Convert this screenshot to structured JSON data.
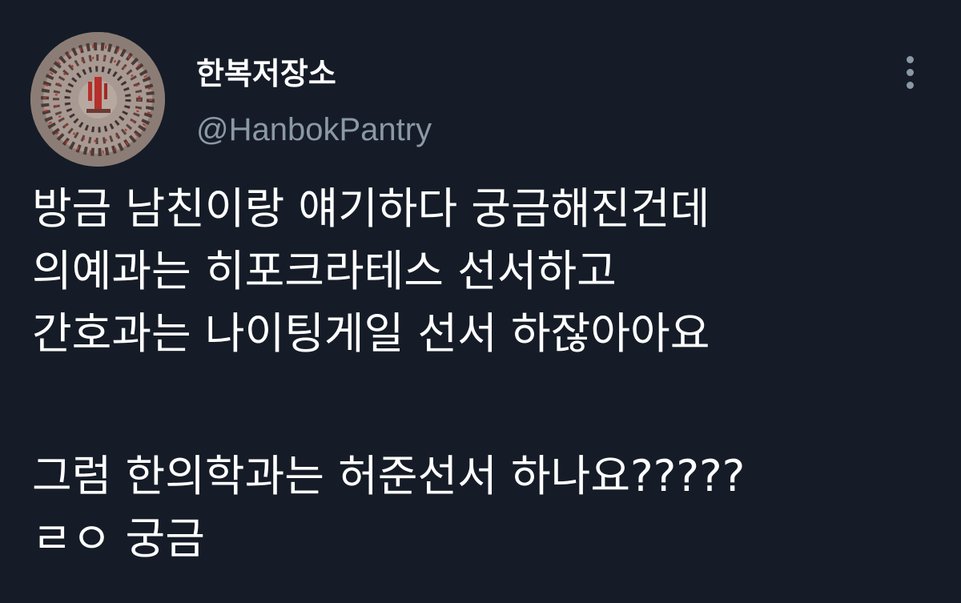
{
  "author": {
    "display_name": "한복저장소",
    "handle": "@HanbokPantry",
    "avatar_icon": "avatar-image"
  },
  "menu": {
    "icon": "more-vertical-icon"
  },
  "tweet": {
    "lines": [
      "방금 남친이랑 얘기하다 궁금해진건데",
      "의예과는 히포크라테스 선서하고",
      "간호과는 나이팅게일 선서 하잖아아요",
      "",
      "그럼 한의학과는 허준선서 하나요?????",
      "ㄹㅇ 궁금"
    ]
  },
  "colors": {
    "background": "#151c27",
    "text": "#ffffff",
    "secondary_text": "#8b98a5"
  }
}
